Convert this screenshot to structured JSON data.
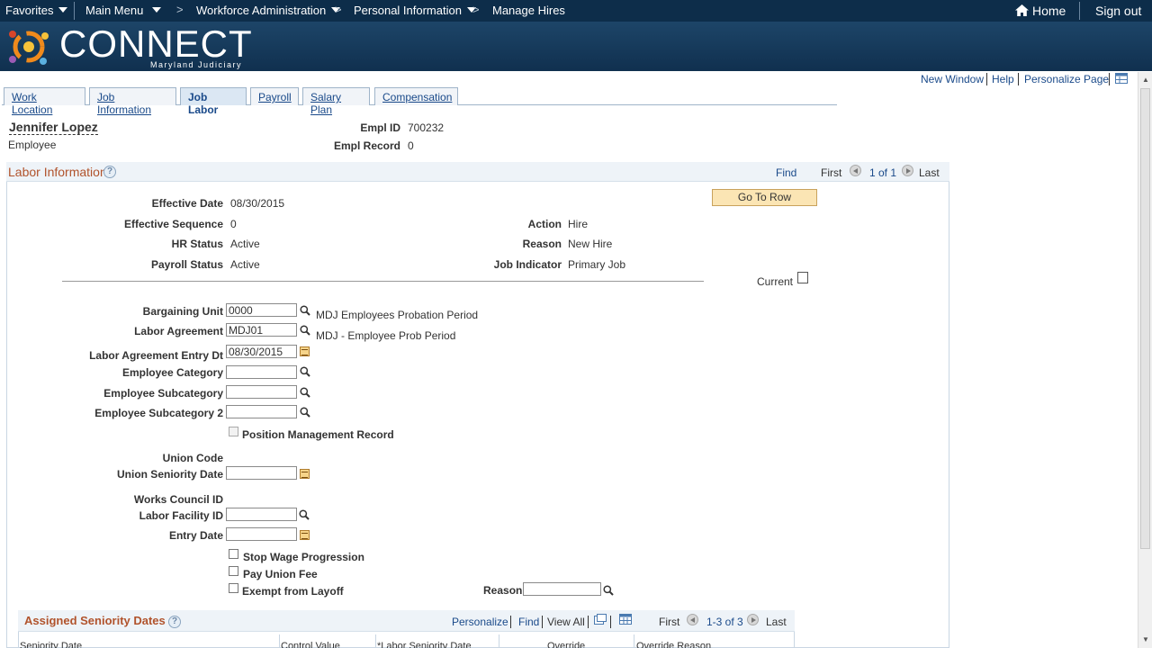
{
  "topnav": {
    "favorites": "Favorites",
    "main_menu": "Main Menu",
    "crumb_1": "Workforce Administration",
    "crumb_2": "Personal Information",
    "crumb_3": "Manage Hires",
    "home": "Home",
    "sign_out": "Sign out"
  },
  "banner": {
    "logo": "CONNECT",
    "subtitle": "Maryland Judiciary"
  },
  "util": {
    "new_window": "New Window",
    "help": "Help",
    "personalize": "Personalize Page"
  },
  "tabs": [
    {
      "label": "Work Location"
    },
    {
      "label": "Job Information"
    },
    {
      "label": "Job Labor"
    },
    {
      "label": "Payroll"
    },
    {
      "label": "Salary Plan"
    },
    {
      "label": "Compensation"
    }
  ],
  "employee": {
    "name": "Jennifer Lopez",
    "role": "Employee",
    "empl_id_label": "Empl ID",
    "empl_id": "700232",
    "empl_record_label": "Empl Record",
    "empl_record": "0"
  },
  "labor": {
    "title": "Labor Information",
    "find": "Find",
    "first": "First",
    "count": "1 of 1",
    "last": "Last",
    "go_to_row": "Go To Row",
    "effective_date_label": "Effective Date",
    "effective_date": "08/30/2015",
    "effective_seq_label": "Effective Sequence",
    "effective_seq": "0",
    "hr_status_label": "HR Status",
    "hr_status": "Active",
    "payroll_status_label": "Payroll Status",
    "payroll_status": "Active",
    "action_label": "Action",
    "action": "Hire",
    "reason_label": "Reason",
    "reason": "New Hire",
    "job_indicator_label": "Job Indicator",
    "job_indicator": "Primary Job",
    "current_label": "Current"
  },
  "fields": {
    "bargaining_unit_label": "Bargaining Unit",
    "bargaining_unit": "0000",
    "bargaining_unit_desc": "MDJ Employees Probation Period",
    "labor_agreement_label": "Labor Agreement",
    "labor_agreement": "MDJ01",
    "labor_agreement_desc": "MDJ - Employee Prob Period",
    "labor_agreement_entry_label": "Labor Agreement Entry Dt",
    "labor_agreement_entry": "08/30/2015",
    "employee_category_label": "Employee Category",
    "employee_subcategory_label": "Employee Subcategory",
    "employee_subcategory2_label": "Employee Subcategory 2",
    "position_mgmt_label": "Position Management Record",
    "union_code_label": "Union Code",
    "union_seniority_label": "Union Seniority Date",
    "works_council_label": "Works Council ID",
    "labor_facility_label": "Labor Facility ID",
    "entry_date_label": "Entry Date",
    "stop_wage_label": "Stop Wage Progression",
    "pay_union_fee_label": "Pay Union Fee",
    "exempt_layoff_label": "Exempt from Layoff",
    "reason_label": "Reason"
  },
  "seniority": {
    "title": "Assigned Seniority Dates",
    "personalize": "Personalize",
    "find": "Find",
    "view_all": "View All",
    "first": "First",
    "count": "1-3 of 3",
    "last": "Last",
    "columns": [
      "Seniority Date",
      "Control Value",
      "*Labor Seniority Date",
      "Override",
      "Override Reason"
    ]
  },
  "colors": {
    "nav": "#0d2d4a",
    "link": "#1a4a8a",
    "section_title": "#b1532c",
    "button": "#fbe5b4"
  }
}
